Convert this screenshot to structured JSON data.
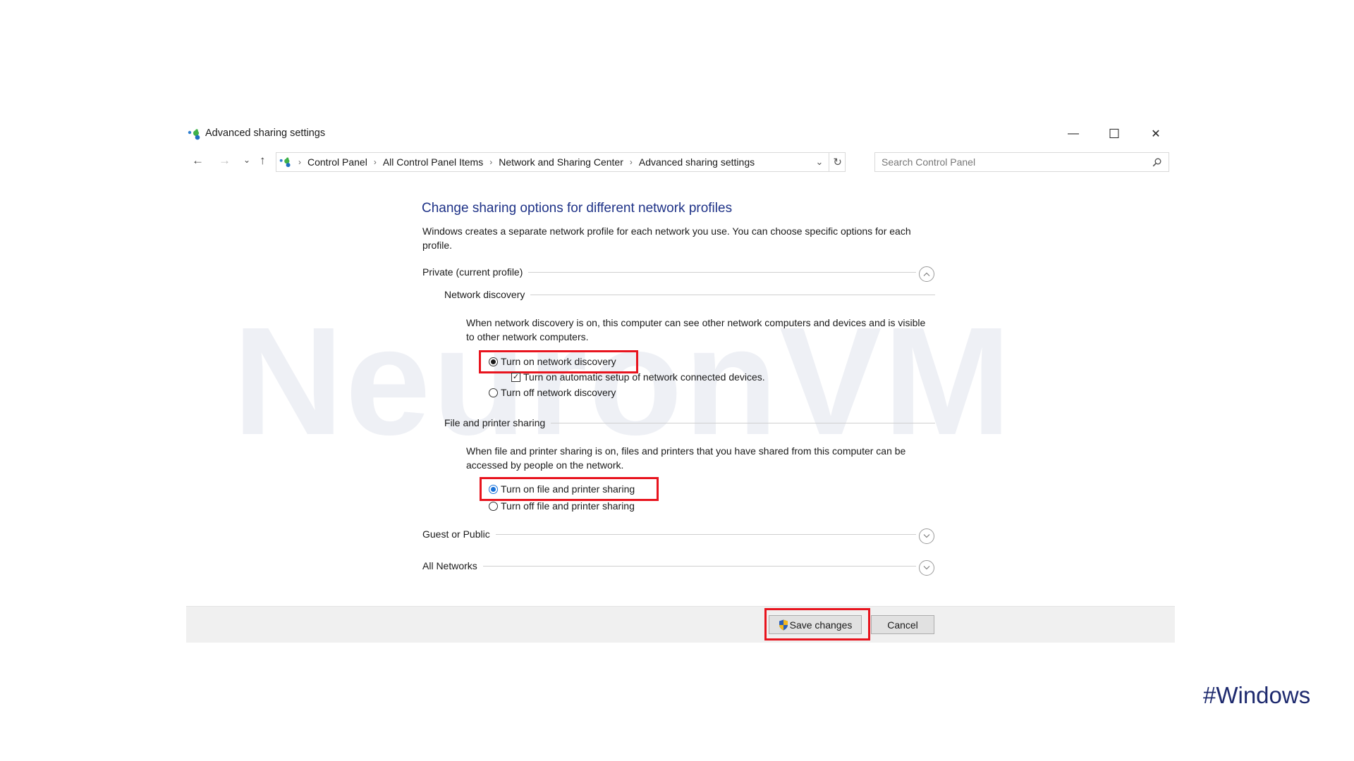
{
  "watermark": "NeuronVM",
  "window": {
    "title": "Advanced sharing settings",
    "icon": "network-sharing-icon",
    "controls": {
      "minimize": "—",
      "maximize": "☐",
      "close": "✕"
    }
  },
  "nav": {
    "back": "←",
    "forward": "→",
    "recent": "⌄",
    "up": "↑",
    "breadcrumb": [
      "Control Panel",
      "All Control Panel Items",
      "Network and Sharing Center",
      "Advanced sharing settings"
    ],
    "separator": "›",
    "dropdown": "⌄",
    "refresh": "↻",
    "search_placeholder": "Search Control Panel",
    "search_icon": "⚲"
  },
  "content": {
    "heading": "Change sharing options for different network profiles",
    "description": "Windows creates a separate network profile for each network you use. You can choose specific options for each profile.",
    "profiles": {
      "private": {
        "label": "Private (current profile)",
        "expanded": true,
        "toggle": "︿"
      },
      "guest": {
        "label": "Guest or Public",
        "expanded": false,
        "toggle": "﹀"
      },
      "all": {
        "label": "All Networks",
        "expanded": false,
        "toggle": "﹀"
      }
    },
    "network_discovery": {
      "label": "Network discovery",
      "description": "When network discovery is on, this computer can see other network computers and devices and is visible to other network computers.",
      "option_on": "Turn on network discovery",
      "option_auto": "Turn on automatic setup of network connected devices.",
      "option_off": "Turn off network discovery",
      "selected": "on",
      "auto_setup_checked": true,
      "check_mark": "✓"
    },
    "file_printer_sharing": {
      "label": "File and printer sharing",
      "description": "When file and printer sharing is on, files and printers that you have shared from this computer can be accessed by people on the network.",
      "option_on": "Turn on file and printer sharing",
      "option_off": "Turn off file and printer sharing",
      "selected": "on"
    }
  },
  "footer": {
    "save": "Save changes",
    "cancel": "Cancel"
  },
  "colors": {
    "heading": "#1e3287",
    "highlight": "#e8141e",
    "radio_blue": "#1a73d9"
  },
  "hashtag": "#Windows"
}
